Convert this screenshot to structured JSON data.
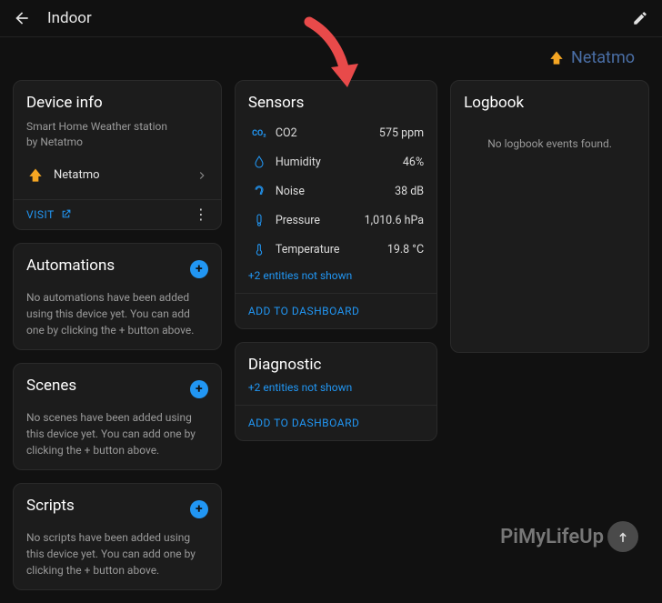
{
  "header": {
    "title": "Indoor"
  },
  "brand": {
    "name": "Netatmo",
    "color": "#4a6ea5"
  },
  "device_info": {
    "title": "Device info",
    "subtitle_line1": "Smart Home Weather station",
    "subtitle_line2": "by Netatmo",
    "integration_name": "Netatmo",
    "visit_label": "VISIT"
  },
  "automations": {
    "title": "Automations",
    "text": "No automations have been added using this device yet. You can add one by clicking the + button above."
  },
  "scenes": {
    "title": "Scenes",
    "text": "No scenes have been added using this device yet. You can add one by clicking the + button above."
  },
  "scripts": {
    "title": "Scripts",
    "text": "No scripts have been added using this device yet. You can add one by clicking the + button above."
  },
  "sensors": {
    "title": "Sensors",
    "rows": [
      {
        "icon": "co2",
        "label": "CO2",
        "value": "575 ppm"
      },
      {
        "icon": "humidity",
        "label": "Humidity",
        "value": "46%"
      },
      {
        "icon": "noise",
        "label": "Noise",
        "value": "38 dB"
      },
      {
        "icon": "pressure",
        "label": "Pressure",
        "value": "1,010.6 hPa"
      },
      {
        "icon": "temperature",
        "label": "Temperature",
        "value": "19.8 °C"
      }
    ],
    "more_link": "+2 entities not shown",
    "footer_btn": "ADD TO DASHBOARD"
  },
  "diagnostic": {
    "title": "Diagnostic",
    "more_link": "+2 entities not shown",
    "footer_btn": "ADD TO DASHBOARD"
  },
  "logbook": {
    "title": "Logbook",
    "empty_msg": "No logbook events found."
  },
  "watermark": {
    "text": "PiMyLifeUp"
  },
  "colors": {
    "accent": "#2196f3",
    "arrow": "#e84a4a"
  }
}
